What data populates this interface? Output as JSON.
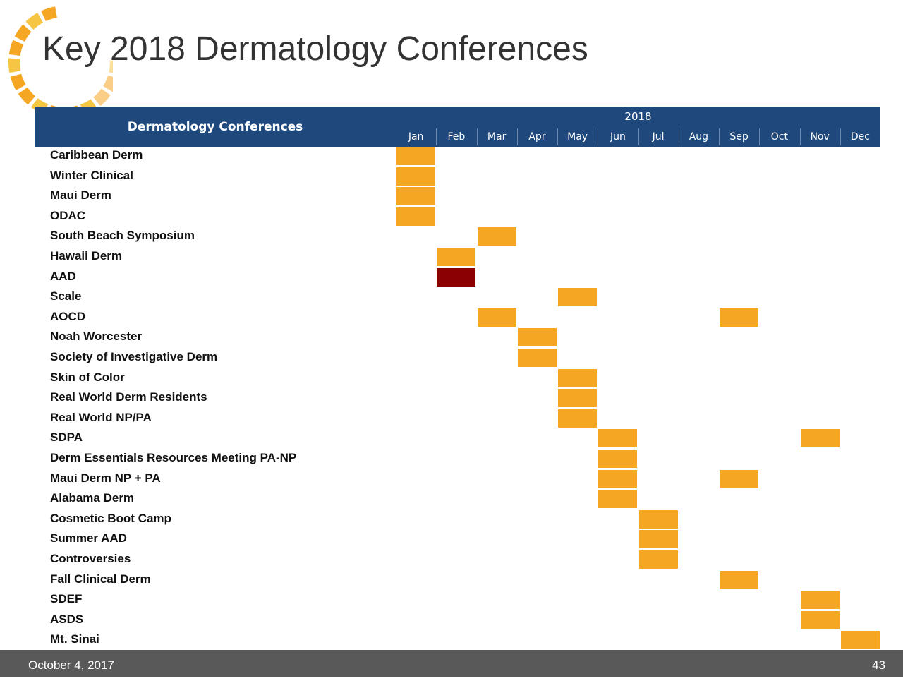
{
  "title": "Key 2018 Dermatology Conferences",
  "colors": {
    "header": "#1f497d",
    "conference": "#f5a623",
    "highlight": "#8b0000",
    "footer": "#595959"
  },
  "logo": {
    "icon": "sunburst-ring-logo-icon"
  },
  "table": {
    "column_header": "Dermatology Conferences",
    "year": "2018",
    "months": [
      "Jan",
      "Feb",
      "Mar",
      "Apr",
      "May",
      "Jun",
      "Jul",
      "Aug",
      "Sep",
      "Oct",
      "Nov",
      "Dec"
    ],
    "rows": [
      {
        "name": "Caribbean Derm",
        "months": [
          1
        ]
      },
      {
        "name": "Winter Clinical",
        "months": [
          1
        ]
      },
      {
        "name": "Maui Derm",
        "months": [
          1
        ]
      },
      {
        "name": "ODAC",
        "months": [
          1
        ]
      },
      {
        "name": "South Beach Symposium",
        "months": [
          3
        ]
      },
      {
        "name": "Hawaii Derm",
        "months": [
          2
        ]
      },
      {
        "name": "AAD",
        "months": [
          2
        ],
        "highlight": true
      },
      {
        "name": "Scale",
        "months": [
          5
        ]
      },
      {
        "name": "AOCD",
        "months": [
          3,
          9
        ]
      },
      {
        "name": "Noah Worcester",
        "months": [
          4
        ]
      },
      {
        "name": "Society of Investigative Derm",
        "months": [
          4
        ]
      },
      {
        "name": "Skin of Color",
        "months": [
          5
        ]
      },
      {
        "name": "Real World Derm Residents",
        "months": [
          5
        ]
      },
      {
        "name": "Real World NP/PA",
        "months": [
          5
        ]
      },
      {
        "name": "SDPA",
        "months": [
          6,
          11
        ]
      },
      {
        "name": "Derm Essentials Resources Meeting PA-NP",
        "months": [
          6
        ]
      },
      {
        "name": "Maui Derm NP + PA",
        "months": [
          6,
          9
        ]
      },
      {
        "name": "Alabama Derm",
        "months": [
          6
        ]
      },
      {
        "name": "Cosmetic Boot Camp",
        "months": [
          7
        ]
      },
      {
        "name": "Summer AAD",
        "months": [
          7
        ]
      },
      {
        "name": "Controversies",
        "months": [
          7
        ]
      },
      {
        "name": "Fall Clinical Derm",
        "months": [
          9
        ]
      },
      {
        "name": "SDEF",
        "months": [
          11
        ]
      },
      {
        "name": "ASDS",
        "months": [
          11
        ]
      },
      {
        "name": "Mt. Sinai",
        "months": [
          12
        ]
      }
    ]
  },
  "footer": {
    "date": "October 4, 2017",
    "page": "43"
  }
}
